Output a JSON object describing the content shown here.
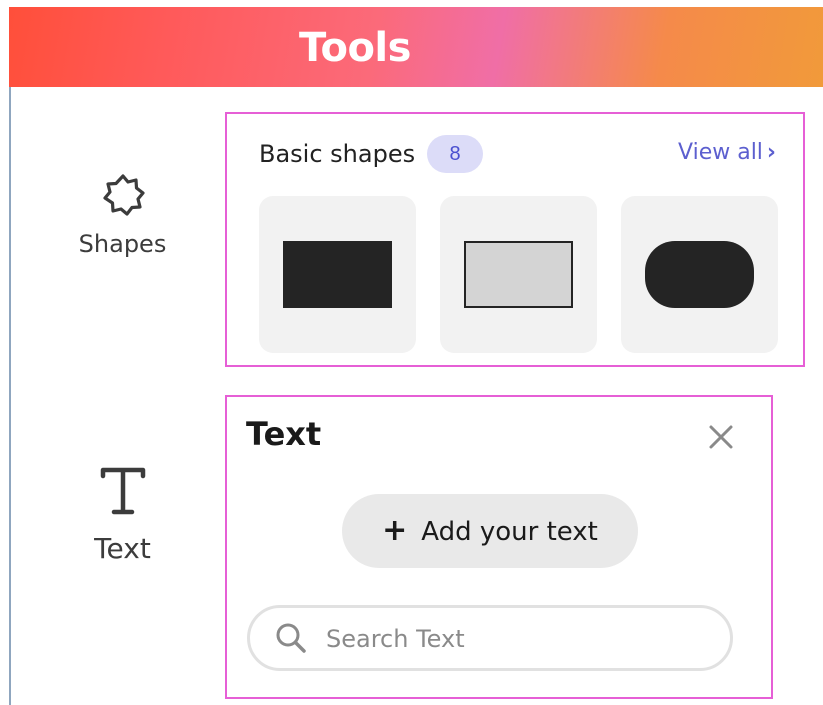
{
  "header": {
    "title": "Tools"
  },
  "rail": {
    "items": [
      {
        "label": "Shapes",
        "icon": "shapes-icon"
      },
      {
        "label": "Text",
        "icon": "text-icon"
      }
    ]
  },
  "shapes_panel": {
    "title": "Basic shapes",
    "count": "8",
    "view_all": "View all",
    "items": [
      {
        "shape": "filled-rectangle"
      },
      {
        "shape": "outlined-rectangle"
      },
      {
        "shape": "rounded-rectangle"
      }
    ]
  },
  "text_panel": {
    "title": "Text",
    "add_button_label": "Add your text",
    "search_placeholder": "Search Text"
  },
  "colors": {
    "accent": "#5c5fcf",
    "panel_border": "#e65fd6",
    "header_gradient_start": "#ff4f3a",
    "header_gradient_end": "#f19a3a"
  }
}
